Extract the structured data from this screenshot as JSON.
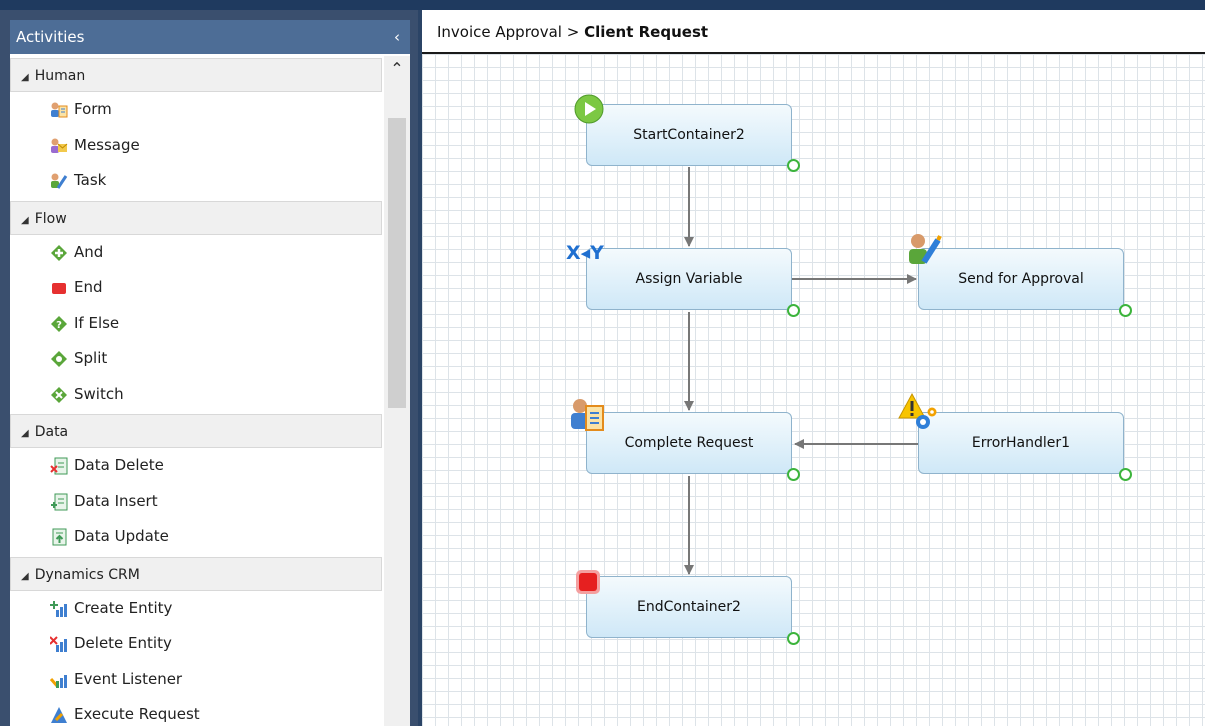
{
  "sidebar": {
    "title": "Activities",
    "collapse_glyph": "‹",
    "scroll_up_glyph": "⌃",
    "categories": [
      {
        "label": "Human",
        "items": [
          {
            "label": "Form",
            "icon": "form-icon"
          },
          {
            "label": "Message",
            "icon": "message-icon"
          },
          {
            "label": "Task",
            "icon": "task-icon"
          }
        ]
      },
      {
        "label": "Flow",
        "items": [
          {
            "label": "And",
            "icon": "and-icon"
          },
          {
            "label": "End",
            "icon": "end-icon"
          },
          {
            "label": "If Else",
            "icon": "if-else-icon"
          },
          {
            "label": "Split",
            "icon": "split-icon"
          },
          {
            "label": "Switch",
            "icon": "switch-icon"
          }
        ]
      },
      {
        "label": "Data",
        "items": [
          {
            "label": "Data Delete",
            "icon": "data-delete-icon"
          },
          {
            "label": "Data Insert",
            "icon": "data-insert-icon"
          },
          {
            "label": "Data Update",
            "icon": "data-update-icon"
          }
        ]
      },
      {
        "label": "Dynamics CRM",
        "items": [
          {
            "label": "Create Entity",
            "icon": "create-entity-icon"
          },
          {
            "label": "Delete Entity",
            "icon": "delete-entity-icon"
          },
          {
            "label": "Event Listener",
            "icon": "event-listener-icon"
          },
          {
            "label": "Execute Request",
            "icon": "execute-request-icon"
          }
        ]
      }
    ]
  },
  "breadcrumb": {
    "parent": "Invoice Approval",
    "separator": ">",
    "current": "Client Request"
  },
  "workflow": {
    "nodes": {
      "start": "StartContainer2",
      "assign": "Assign Variable",
      "approval": "Send for Approval",
      "complete": "Complete Request",
      "error": "ErrorHandler1",
      "end": "EndContainer2"
    },
    "assign_badge": "X◂Y"
  },
  "colors": {
    "header": "#4d6d96",
    "port": "#3cb43c",
    "node_border": "#8fb3cc",
    "edge": "#777777"
  }
}
